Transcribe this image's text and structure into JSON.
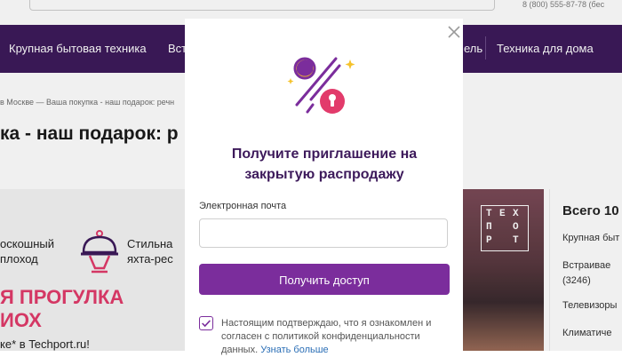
{
  "header": {
    "phone": "8 (800) 555-87-78 (бес"
  },
  "nav": {
    "items": [
      {
        "label": "Крупная бытовая техника"
      },
      {
        "label": "Вст"
      },
      {
        "label": "ель"
      },
      {
        "label": "Техника для дома"
      }
    ]
  },
  "breadcrumb": "в Москве — Ваша покупка - наш подарок: речн",
  "page_title": "ка - наш подарок: р",
  "banner": {
    "benefit1_line1": "оскошный",
    "benefit1_line2": "плоход",
    "benefit2_line1": "Стильна",
    "benefit2_line2": "яхта-рес",
    "promo_line1": "Я ПРОГУЛКА",
    "promo_line2": "ИОХ",
    "promo_small": "ке* в Techport.ru!",
    "logo_letters": [
      "Т",
      "Е",
      "Х",
      "П",
      "О",
      "Р",
      "Т"
    ]
  },
  "sidebar": {
    "title": "Всего 10",
    "items": [
      {
        "label": "Крупная быт"
      },
      {
        "label": "Встраивае"
      },
      {
        "label": "(3246)"
      },
      {
        "label": "Телевизоры"
      },
      {
        "label": "Климатиче"
      }
    ]
  },
  "modal": {
    "title": "Получите приглашение на закрытую распродажу",
    "email_label": "Электронная почта",
    "email_value": "",
    "submit_label": "Получить доступ",
    "consent_text": "Настоящим подтверждаю, что я ознакомлен и согласен с политикой конфиденциальности данных.",
    "consent_link": "Узнать больше",
    "consent_checked": true,
    "colors": {
      "brand_purple": "#7b2d9c",
      "title_purple": "#3d1a5b",
      "accent_pink": "#e23b6b",
      "accent_yellow": "#f5c22b"
    }
  },
  "icons": {
    "close": "close-icon",
    "percent": "percent-lock-icon",
    "checkmark": "checkmark-icon",
    "cloche": "cloche-icon"
  }
}
